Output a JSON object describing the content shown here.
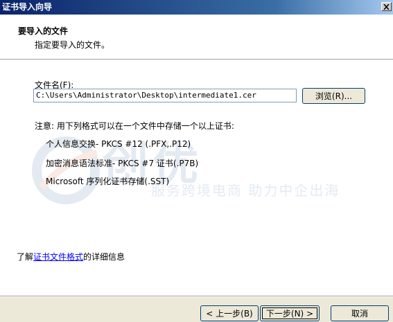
{
  "window": {
    "title": "证书导入向导"
  },
  "header": {
    "title": "要导入的文件",
    "subtitle": "指定要导入的文件。"
  },
  "file": {
    "label": "文件名(F):",
    "value": "C:\\Users\\Administrator\\Desktop\\intermediate1.cer",
    "browse_label": "浏览(R)..."
  },
  "note": "注意: 用下列格式可以在一个文件中存储一个以上证书:",
  "formats": [
    "个人信息交换- PKCS #12 (.PFX,.P12)",
    "加密消息语法标准- PKCS #7 证书(.P7B)",
    "Microsoft 序列化证书存储(.SST)"
  ],
  "watermark": {
    "brand": "创优",
    "slogan": "服务跨境电商 助力中企出海"
  },
  "learn_more": {
    "prefix": "了解",
    "link": "证书文件格式",
    "suffix": "的详细信息"
  },
  "buttons": {
    "back": "< 上一步(B)",
    "next": "下一步(N) >",
    "cancel": "取消"
  },
  "icons": {
    "close": "close-icon"
  },
  "colors": {
    "titlebar": "#0a246a",
    "link": "#0000ff"
  }
}
